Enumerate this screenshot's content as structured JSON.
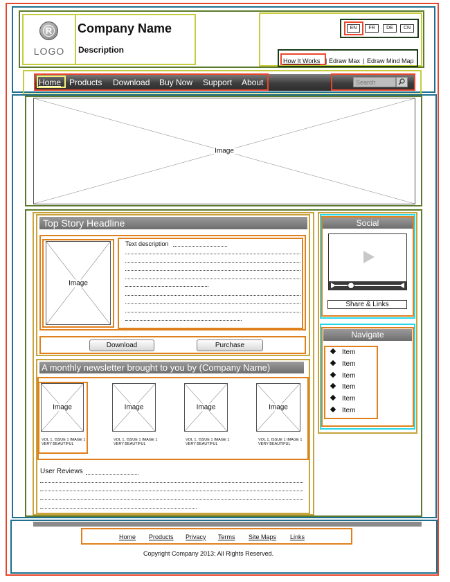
{
  "header": {
    "logo_text": "LOGO",
    "logo_mark": "R",
    "company_name": "Company Name",
    "description": "Description",
    "languages": [
      "EN",
      "FR",
      "DE",
      "CN"
    ],
    "top_links": [
      "How It Works",
      "Edraw Max",
      "Edraw Mind Map"
    ],
    "link_separator": "|"
  },
  "nav": {
    "items": [
      "Home",
      "Products",
      "Download",
      "Buy Now",
      "Support",
      "About"
    ],
    "search_placeholder": "Search",
    "search_icon": "search-icon"
  },
  "banner": {
    "label": "Image"
  },
  "top_story": {
    "headline": "Top Story Headline",
    "image_label": "Image",
    "text_description": "Text description",
    "buttons": {
      "download": "Download",
      "purchase": "Purchase"
    }
  },
  "newsletter": {
    "title": "A monthly newsletter brought to you by (Company Name)",
    "cards": [
      {
        "label": "Image",
        "caption": "VOL 1, ISSUE 1 IMAGE 1 VERY BEAUTIFUL"
      },
      {
        "label": "Image",
        "caption": "VOL 1, ISSUE 1 IMAGE 1 VERY BEAUTIFUL"
      },
      {
        "label": "Image",
        "caption": "VOL 1, ISSUE 1 IMAGE 1 VERY BEAUTIFUL"
      },
      {
        "label": "Image",
        "caption": "VOL 1, ISSUE 1 IMAGE 1 VERY BEAUTIFUL"
      }
    ],
    "reviews_label": "User Reviews"
  },
  "social": {
    "title": "Social",
    "share_label": "Share & Links",
    "play_icon": "play-icon"
  },
  "navigate": {
    "title": "Navigate",
    "items": [
      "Item",
      "Item",
      "Item",
      "Item",
      "Item",
      "Item"
    ]
  },
  "footer": {
    "links": [
      "Home",
      "Products",
      "Privacy",
      "Terms",
      "Site Maps",
      "Links"
    ],
    "copyright": "Copyright Company 2013; All Rights Reserved."
  },
  "colors": {
    "frame_red": "#e8452c",
    "frame_blue": "#1d6f8f",
    "frame_green": "#5b7a2b",
    "frame_lime": "#c6cc3e",
    "frame_orange": "#e0801c",
    "frame_cyan": "#27d8e8",
    "nav_bar": "#3d3d3d",
    "section_header": "#7f7f7f"
  }
}
